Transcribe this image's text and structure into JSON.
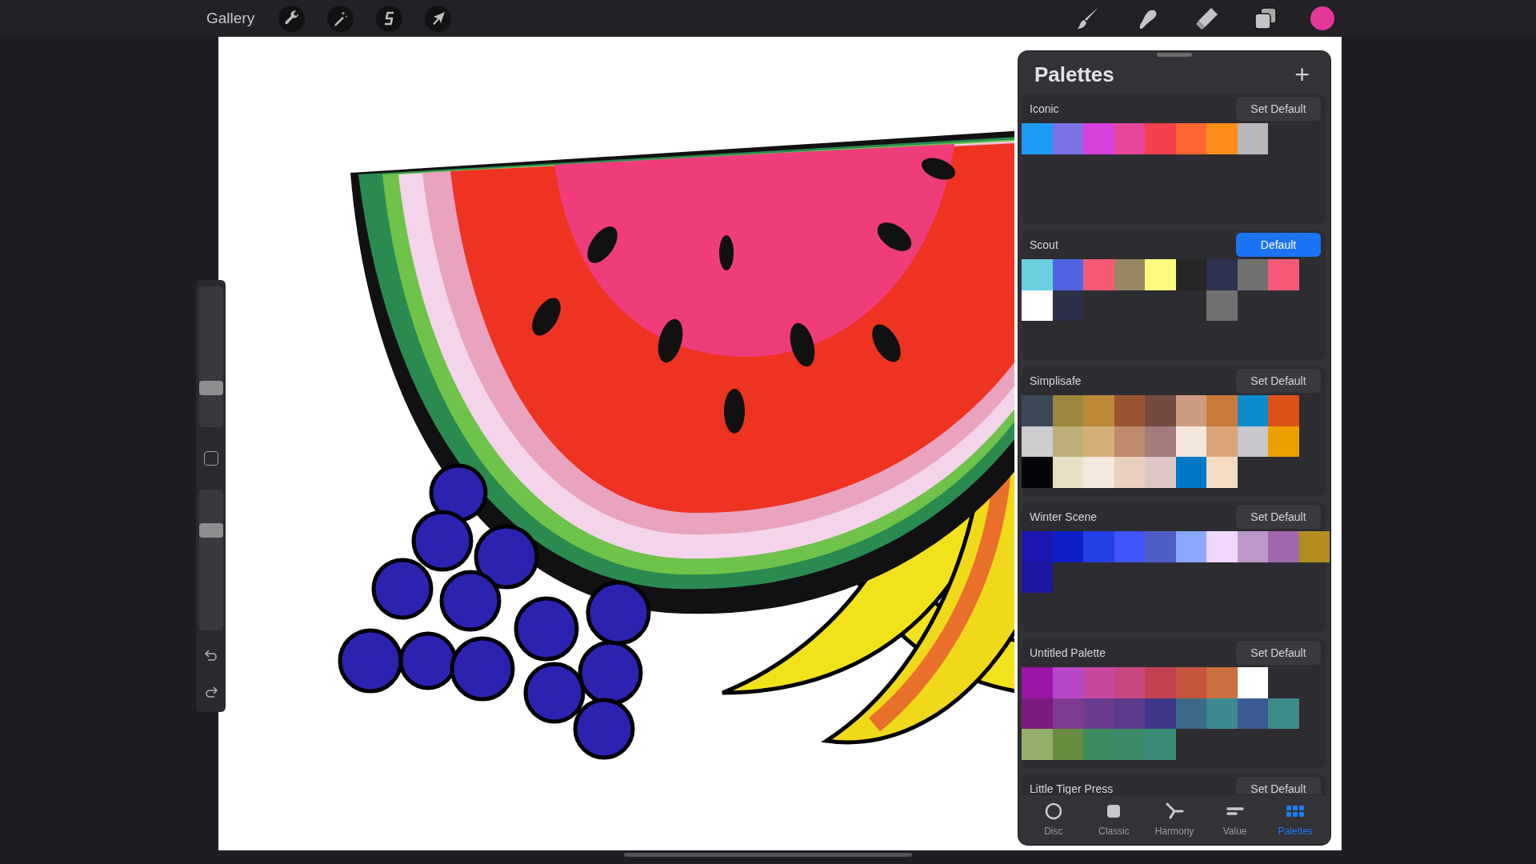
{
  "topbar": {
    "gallery": "Gallery",
    "current_color": {
      "color": "#e5369a"
    }
  },
  "sidebar": {
    "brush_size": {
      "level": 0.28
    },
    "opacity": {
      "level": 0.71
    }
  },
  "palettes_panel": {
    "title": "Palettes",
    "add": "+",
    "palettes": [
      {
        "name": "Iconic",
        "button": "Set Default",
        "default": false,
        "swatches": [
          {
            "kind": "color",
            "color": "#1d9bf6"
          },
          {
            "kind": "color",
            "color": "#7c72e6"
          },
          {
            "kind": "color",
            "color": "#d640dc"
          },
          {
            "kind": "color",
            "color": "#e8469a"
          },
          {
            "kind": "color",
            "color": "#f7404f"
          },
          {
            "kind": "color",
            "color": "#ff6533"
          },
          {
            "kind": "color",
            "color": "#ff8d1a"
          },
          {
            "kind": "color",
            "color": "#b8b8ba"
          }
        ]
      },
      {
        "name": "Scout",
        "button": "Default",
        "default": true,
        "swatches": [
          {
            "kind": "color",
            "color": "#6ad0de"
          },
          {
            "kind": "color",
            "color": "#5163e0"
          },
          {
            "kind": "color",
            "color": "#f75a75"
          },
          {
            "kind": "color",
            "color": "#978760"
          },
          {
            "kind": "color",
            "color": "#fdfb7f"
          },
          {
            "kind": "color",
            "color": "#262626"
          },
          {
            "kind": "color",
            "color": "#2e3050"
          },
          {
            "kind": "color",
            "color": "#707070"
          },
          {
            "kind": "color",
            "color": "#f55a78"
          },
          {
            "kind": "empty"
          },
          {
            "kind": "color",
            "color": "#ffffff"
          },
          {
            "kind": "color",
            "color": "#2b2f48"
          },
          {
            "kind": "empty"
          },
          {
            "kind": "empty"
          },
          {
            "kind": "empty"
          },
          {
            "kind": "empty"
          },
          {
            "kind": "color",
            "color": "#707070"
          }
        ]
      },
      {
        "name": "Simplisafe",
        "button": "Set Default",
        "default": false,
        "swatches": [
          {
            "kind": "color",
            "color": "#3b4858"
          },
          {
            "kind": "color",
            "color": "#9b873c"
          },
          {
            "kind": "color",
            "color": "#bd8a38"
          },
          {
            "kind": "color",
            "color": "#9a5533"
          },
          {
            "kind": "color",
            "color": "#734a3e"
          },
          {
            "kind": "color",
            "color": "#cc9b80"
          },
          {
            "kind": "color",
            "color": "#cb7a3a"
          },
          {
            "kind": "color",
            "color": "#0a8ccc"
          },
          {
            "kind": "color",
            "color": "#dc5116"
          },
          {
            "kind": "empty"
          },
          {
            "kind": "color",
            "color": "#cdcdcf"
          },
          {
            "kind": "color",
            "color": "#bcae7a"
          },
          {
            "kind": "color",
            "color": "#d4ae76"
          },
          {
            "kind": "color",
            "color": "#bd8a6c"
          },
          {
            "kind": "color",
            "color": "#a47b7c"
          },
          {
            "kind": "color",
            "color": "#f5e7dc"
          },
          {
            "kind": "color",
            "color": "#dba378"
          },
          {
            "kind": "color",
            "color": "#c6c8cb"
          },
          {
            "kind": "color",
            "color": "#eda000"
          },
          {
            "kind": "empty"
          },
          {
            "kind": "color",
            "color": "#050408"
          },
          {
            "kind": "color",
            "color": "#e8dfc7"
          },
          {
            "kind": "color",
            "color": "#f5e9df"
          },
          {
            "kind": "color",
            "color": "#e8cfbf"
          },
          {
            "kind": "color",
            "color": "#dcc6c6"
          },
          {
            "kind": "color",
            "color": "#0078c8"
          },
          {
            "kind": "color",
            "color": "#f4dcc3"
          }
        ]
      },
      {
        "name": "Winter Scene",
        "button": "Set Default",
        "default": false,
        "swatches": [
          {
            "kind": "color",
            "color": "#1b17b0"
          },
          {
            "kind": "color",
            "color": "#0f20c8"
          },
          {
            "kind": "color",
            "color": "#2340e6"
          },
          {
            "kind": "color",
            "color": "#3f55fe"
          },
          {
            "kind": "color",
            "color": "#4f5fc7"
          },
          {
            "kind": "color",
            "color": "#8aa8fd"
          },
          {
            "kind": "color",
            "color": "#f0d7fd"
          },
          {
            "kind": "color",
            "color": "#bb98c8"
          },
          {
            "kind": "color",
            "color": "#a067ad"
          },
          {
            "kind": "color",
            "color": "#b38e1f"
          },
          {
            "kind": "color",
            "color": "#1b17a0"
          }
        ]
      },
      {
        "name": "Untitled Palette",
        "button": "Set Default",
        "default": false,
        "swatches": [
          {
            "kind": "color",
            "color": "#9c16a8"
          },
          {
            "kind": "color",
            "color": "#b846c8"
          },
          {
            "kind": "color",
            "color": "#c7489f"
          },
          {
            "kind": "color",
            "color": "#c84780"
          },
          {
            "kind": "color",
            "color": "#c24250"
          },
          {
            "kind": "color",
            "color": "#c5553f"
          },
          {
            "kind": "color",
            "color": "#c87040"
          },
          {
            "kind": "color",
            "color": "#ffffff"
          },
          {
            "kind": "empty"
          },
          {
            "kind": "empty"
          },
          {
            "kind": "color",
            "color": "#7b1a7f"
          },
          {
            "kind": "color",
            "color": "#7f3c8f"
          },
          {
            "kind": "color",
            "color": "#6c3c8f"
          },
          {
            "kind": "color",
            "color": "#5c3a8c"
          },
          {
            "kind": "color",
            "color": "#3f3888"
          },
          {
            "kind": "color",
            "color": "#3c6a8b"
          },
          {
            "kind": "color",
            "color": "#3c8a8f"
          },
          {
            "kind": "color",
            "color": "#3c5a93"
          },
          {
            "kind": "color",
            "color": "#3c8c8a"
          },
          {
            "kind": "empty"
          },
          {
            "kind": "color",
            "color": "#95b06c"
          },
          {
            "kind": "color",
            "color": "#6a8c40"
          },
          {
            "kind": "color",
            "color": "#3c8c60"
          },
          {
            "kind": "color",
            "color": "#3c8a66"
          },
          {
            "kind": "color",
            "color": "#3c8a78"
          }
        ]
      },
      {
        "name": "Little Tiger Press",
        "button": "Set Default",
        "default": false
      }
    ],
    "tabs": [
      {
        "label": "Disc",
        "selected": false
      },
      {
        "label": "Classic",
        "selected": false
      },
      {
        "label": "Harmony",
        "selected": false
      },
      {
        "label": "Value",
        "selected": false
      },
      {
        "label": "Palettes",
        "selected": true
      }
    ]
  }
}
